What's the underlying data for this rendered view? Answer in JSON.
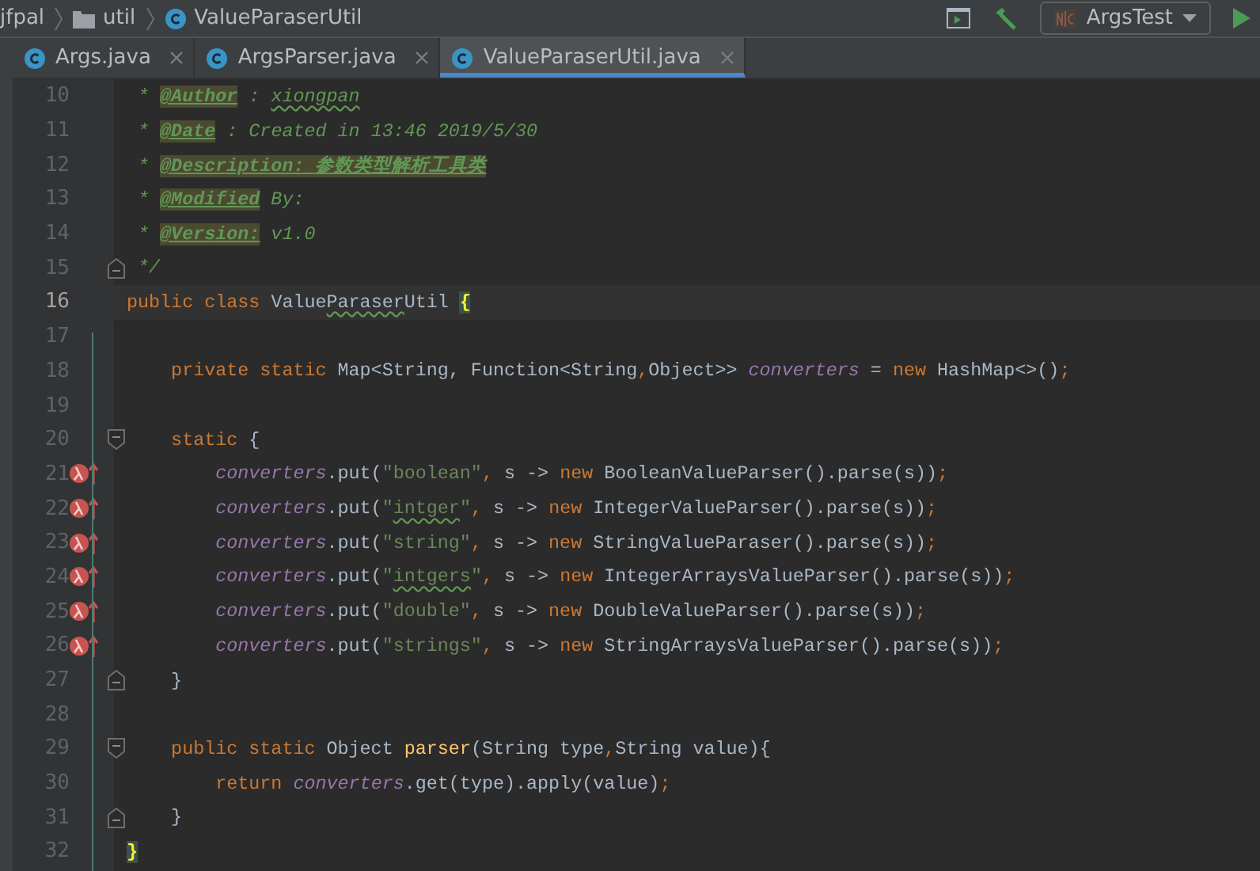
{
  "breadcrumb": [
    {
      "label": "jfpal",
      "kind": "project"
    },
    {
      "label": "util",
      "kind": "folder"
    },
    {
      "label": "ValueParaserUtil",
      "kind": "class"
    }
  ],
  "run_config": {
    "label": "ArgsTest"
  },
  "tabs": [
    {
      "label": "Args.java",
      "selected": false
    },
    {
      "label": "ArgsParser.java",
      "selected": false
    },
    {
      "label": "ValueParaserUtil.java",
      "selected": true
    }
  ],
  "lines": [
    {
      "number": "10",
      "current": false,
      "lambda": false,
      "fold_start": false,
      "fold_end": false,
      "tokens": [
        {
          "text": " * ",
          "kind": "c"
        },
        {
          "text": "@Author",
          "kind": "t"
        },
        {
          "text": " : ",
          "kind": "c"
        },
        {
          "text": "xiongpan",
          "kind": "cw"
        }
      ]
    },
    {
      "number": "11",
      "current": false,
      "lambda": false,
      "fold_start": false,
      "fold_end": false,
      "tokens": [
        {
          "text": " * ",
          "kind": "c"
        },
        {
          "text": "@Date",
          "kind": "t"
        },
        {
          "text": " : Created in 13:46 2019/5/30",
          "kind": "c"
        }
      ]
    },
    {
      "number": "12",
      "current": false,
      "lambda": false,
      "fold_start": false,
      "fold_end": false,
      "tokens": [
        {
          "text": " * ",
          "kind": "c"
        },
        {
          "text": "@Description: 参数类型解析工具类",
          "kind": "t"
        }
      ]
    },
    {
      "number": "13",
      "current": false,
      "lambda": false,
      "fold_start": false,
      "fold_end": false,
      "tokens": [
        {
          "text": " * ",
          "kind": "c"
        },
        {
          "text": "@Modified",
          "kind": "t"
        },
        {
          "text": " By:",
          "kind": "c"
        }
      ]
    },
    {
      "number": "14",
      "current": false,
      "lambda": false,
      "fold_start": false,
      "fold_end": false,
      "tokens": [
        {
          "text": " * ",
          "kind": "c"
        },
        {
          "text": "@Version:",
          "kind": "t"
        },
        {
          "text": " v1.0",
          "kind": "c"
        }
      ]
    },
    {
      "number": "15",
      "current": false,
      "lambda": false,
      "fold_start": false,
      "fold_end": true,
      "tokens": [
        {
          "text": " */",
          "kind": "c"
        }
      ]
    },
    {
      "number": "16",
      "current": true,
      "lambda": false,
      "fold_start": false,
      "fold_end": false,
      "tokens": [
        {
          "text": "public class ",
          "kind": "k"
        },
        {
          "text": "Value",
          "kind": "p"
        },
        {
          "text": "Paraser",
          "kind": "w"
        },
        {
          "text": "Util ",
          "kind": "p"
        },
        {
          "text": "{",
          "kind": "m"
        }
      ]
    },
    {
      "number": "17",
      "current": false,
      "lambda": false,
      "fold_start": false,
      "fold_end": false
    },
    {
      "number": "18",
      "current": false,
      "lambda": false,
      "fold_start": false,
      "fold_end": false,
      "tokens": [
        {
          "text": "    private static ",
          "kind": "k"
        },
        {
          "text": "Map<String, Function<String",
          "kind": "p"
        },
        {
          "text": ",",
          "kind": "k"
        },
        {
          "text": "Object>> ",
          "kind": "p"
        },
        {
          "text": "converters",
          "kind": "f"
        },
        {
          "text": " = ",
          "kind": "p"
        },
        {
          "text": "new ",
          "kind": "k"
        },
        {
          "text": "HashMap<>()",
          "kind": "p"
        },
        {
          "text": ";",
          "kind": "k"
        }
      ]
    },
    {
      "number": "19",
      "current": false,
      "lambda": false,
      "fold_start": false,
      "fold_end": false
    },
    {
      "number": "20",
      "current": false,
      "lambda": false,
      "fold_start": true,
      "fold_end": false,
      "tokens": [
        {
          "text": "    static ",
          "kind": "k"
        },
        {
          "text": "{",
          "kind": "p"
        }
      ]
    },
    {
      "number": "21",
      "current": false,
      "lambda": true,
      "fold_start": false,
      "fold_end": false,
      "tokens": [
        {
          "text": "        converters",
          "kind": "f"
        },
        {
          "text": ".put(",
          "kind": "p"
        },
        {
          "text": "\"boolean\"",
          "kind": "s"
        },
        {
          "text": ", ",
          "kind": "k"
        },
        {
          "text": "s -> ",
          "kind": "p"
        },
        {
          "text": "new ",
          "kind": "k"
        },
        {
          "text": "BooleanValueParser().parse(s))",
          "kind": "p"
        },
        {
          "text": ";",
          "kind": "k"
        }
      ]
    },
    {
      "number": "22",
      "current": false,
      "lambda": true,
      "fold_start": false,
      "fold_end": false,
      "tokens": [
        {
          "text": "        converters",
          "kind": "f"
        },
        {
          "text": ".put(",
          "kind": "p"
        },
        {
          "text": "\"",
          "kind": "s"
        },
        {
          "text": "intger",
          "kind": "sw"
        },
        {
          "text": "\"",
          "kind": "s"
        },
        {
          "text": ", ",
          "kind": "k"
        },
        {
          "text": "s -> ",
          "kind": "p"
        },
        {
          "text": "new ",
          "kind": "k"
        },
        {
          "text": "IntegerValueParser().parse(s))",
          "kind": "p"
        },
        {
          "text": ";",
          "kind": "k"
        }
      ]
    },
    {
      "number": "23",
      "current": false,
      "lambda": true,
      "fold_start": false,
      "fold_end": false,
      "tokens": [
        {
          "text": "        converters",
          "kind": "f"
        },
        {
          "text": ".put(",
          "kind": "p"
        },
        {
          "text": "\"string\"",
          "kind": "s"
        },
        {
          "text": ", ",
          "kind": "k"
        },
        {
          "text": "s -> ",
          "kind": "p"
        },
        {
          "text": "new ",
          "kind": "k"
        },
        {
          "text": "StringValueParaser().parse(s))",
          "kind": "p"
        },
        {
          "text": ";",
          "kind": "k"
        }
      ]
    },
    {
      "number": "24",
      "current": false,
      "lambda": true,
      "fold_start": false,
      "fold_end": false,
      "tokens": [
        {
          "text": "        converters",
          "kind": "f"
        },
        {
          "text": ".put(",
          "kind": "p"
        },
        {
          "text": "\"",
          "kind": "s"
        },
        {
          "text": "intgers",
          "kind": "sw"
        },
        {
          "text": "\"",
          "kind": "s"
        },
        {
          "text": ", ",
          "kind": "k"
        },
        {
          "text": "s -> ",
          "kind": "p"
        },
        {
          "text": "new ",
          "kind": "k"
        },
        {
          "text": "IntegerArraysValueParser().parse(s))",
          "kind": "p"
        },
        {
          "text": ";",
          "kind": "k"
        }
      ]
    },
    {
      "number": "25",
      "current": false,
      "lambda": true,
      "fold_start": false,
      "fold_end": false,
      "tokens": [
        {
          "text": "        converters",
          "kind": "f"
        },
        {
          "text": ".put(",
          "kind": "p"
        },
        {
          "text": "\"double\"",
          "kind": "s"
        },
        {
          "text": ", ",
          "kind": "k"
        },
        {
          "text": "s -> ",
          "kind": "p"
        },
        {
          "text": "new ",
          "kind": "k"
        },
        {
          "text": "DoubleValueParser().parse(s))",
          "kind": "p"
        },
        {
          "text": ";",
          "kind": "k"
        }
      ]
    },
    {
      "number": "26",
      "current": false,
      "lambda": true,
      "fold_start": false,
      "fold_end": false,
      "tokens": [
        {
          "text": "        converters",
          "kind": "f"
        },
        {
          "text": ".put(",
          "kind": "p"
        },
        {
          "text": "\"strings\"",
          "kind": "s"
        },
        {
          "text": ", ",
          "kind": "k"
        },
        {
          "text": "s -> ",
          "kind": "p"
        },
        {
          "text": "new ",
          "kind": "k"
        },
        {
          "text": "StringArraysValueParser().parse(s))",
          "kind": "p"
        },
        {
          "text": ";",
          "kind": "k"
        }
      ]
    },
    {
      "number": "27",
      "current": false,
      "lambda": false,
      "fold_start": false,
      "fold_end": true,
      "tokens": [
        {
          "text": "    }",
          "kind": "p"
        }
      ]
    },
    {
      "number": "28",
      "current": false,
      "lambda": false,
      "fold_start": false,
      "fold_end": false
    },
    {
      "number": "29",
      "current": false,
      "lambda": false,
      "fold_start": true,
      "fold_end": false,
      "tokens": [
        {
          "text": "    public static ",
          "kind": "k"
        },
        {
          "text": "Object ",
          "kind": "p"
        },
        {
          "text": "parser",
          "kind": "y"
        },
        {
          "text": "(String type",
          "kind": "p"
        },
        {
          "text": ",",
          "kind": "k"
        },
        {
          "text": "String value){",
          "kind": "p"
        }
      ]
    },
    {
      "number": "30",
      "current": false,
      "lambda": false,
      "fold_start": false,
      "fold_end": false,
      "tokens": [
        {
          "text": "        return ",
          "kind": "k"
        },
        {
          "text": "converters",
          "kind": "f"
        },
        {
          "text": ".get(type).apply(value)",
          "kind": "p"
        },
        {
          "text": ";",
          "kind": "k"
        }
      ]
    },
    {
      "number": "31",
      "current": false,
      "lambda": false,
      "fold_start": false,
      "fold_end": true,
      "tokens": [
        {
          "text": "    }",
          "kind": "p"
        }
      ]
    },
    {
      "number": "32",
      "current": false,
      "lambda": false,
      "fold_start": false,
      "fold_end": false,
      "tokens": [
        {
          "text": "}",
          "kind": "m"
        }
      ]
    }
  ]
}
